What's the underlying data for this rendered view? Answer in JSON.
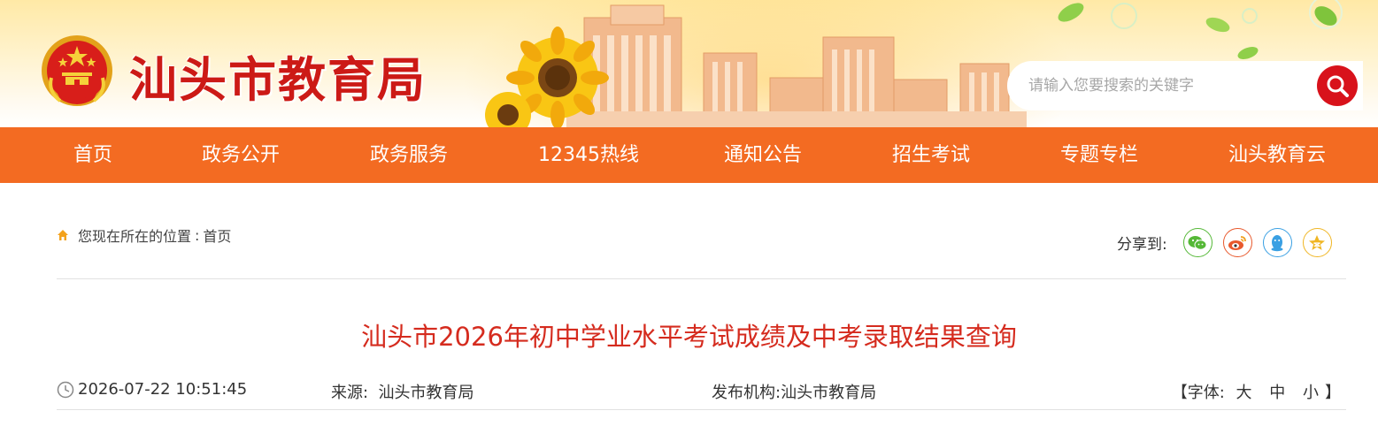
{
  "header": {
    "site_title": "汕头市教育局",
    "search_placeholder": "请输入您要搜索的关键字"
  },
  "nav": {
    "items": [
      {
        "label": "首页"
      },
      {
        "label": "政务公开"
      },
      {
        "label": "政务服务"
      },
      {
        "label": "12345热线"
      },
      {
        "label": "通知公告"
      },
      {
        "label": "招生考试"
      },
      {
        "label": "专题专栏"
      },
      {
        "label": "汕头教育云"
      }
    ]
  },
  "breadcrumb": {
    "prefix": "您现在所在的位置",
    "separator": ":",
    "current": "首页"
  },
  "share": {
    "label": "分享到:",
    "targets": [
      "wechat-icon",
      "weibo-icon",
      "qq-icon",
      "qzone-icon"
    ]
  },
  "article": {
    "title": "汕头市2026年初中学业水平考试成绩及中考录取结果查询",
    "date": "2026-07-22 10:51:45",
    "source_label": "来源:",
    "source_value": "汕头市教育局",
    "publisher_label": "发布机构:",
    "publisher_value": "汕头市教育局",
    "font_open": "【字体:",
    "font_large": "大",
    "font_medium": "中",
    "font_small": "小",
    "font_close": "】"
  },
  "colors": {
    "nav_bg": "#f36b22",
    "title_red": "#d52b1e",
    "brand_red": "#cc1a16",
    "search_btn": "#d8121b"
  }
}
